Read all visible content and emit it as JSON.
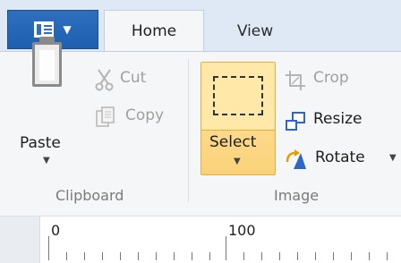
{
  "tabs": {
    "home": "Home",
    "view": "View"
  },
  "clipboard": {
    "paste": "Paste",
    "cut": "Cut",
    "copy": "Copy",
    "group_label": "Clipboard"
  },
  "image": {
    "select": "Select",
    "crop": "Crop",
    "resize": "Resize",
    "rotate": "Rotate",
    "group_label": "Image"
  },
  "ruler": {
    "labels": [
      "0",
      "100"
    ]
  },
  "icons": {
    "file_menu": "paint-menu-icon",
    "paste": "clipboard-icon",
    "cut": "scissors-icon",
    "copy": "copy-icon",
    "crop": "crop-icon",
    "resize": "resize-icon",
    "rotate": "rotate-icon"
  },
  "colors": {
    "file_button": "#2f6fbe",
    "select_highlight": "#fbd27a",
    "ribbon_bg": "#f5f6f7"
  }
}
